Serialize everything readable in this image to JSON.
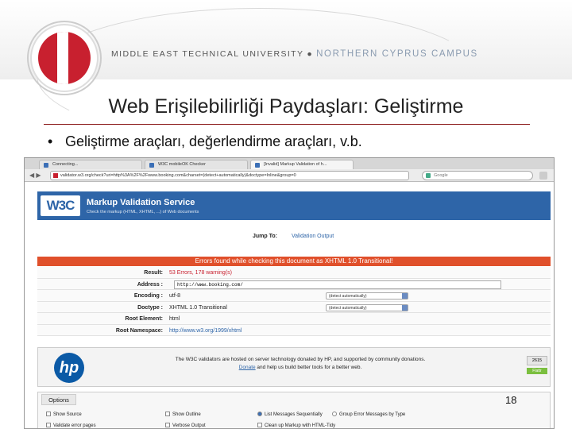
{
  "header": {
    "university": "MIDDLE EAST TECHNICAL UNIVERSITY",
    "separator": "●",
    "campus": "NORTHERN CYPRUS CAMPUS"
  },
  "slide": {
    "title": "Web Erişilebilirliği Paydaşları: Geliştirme",
    "bullet_marker": "•",
    "bullet": "Geliştirme araçları, değerlendirme araçları, v.b.",
    "page_number": "18"
  },
  "browser": {
    "tabs": [
      {
        "label": "Connecting..."
      },
      {
        "label": "W3C mobileOK Checker"
      },
      {
        "label": "[Invalid] Markup Validation of h..."
      }
    ],
    "nav_glyphs": "◀ ▶",
    "url": "validator.w3.org/check?uri=http%3A%2F%2Fwww.booking.com&charset=(detect+automatically)&doctype=Inline&group=0",
    "search_placeholder": "Google"
  },
  "validator": {
    "logo": "W3C",
    "title": "Markup Validation Service",
    "subtitle": "Check the markup (HTML, XHTML, ...) of Web documents",
    "jump_label": "Jump To:",
    "jump_link": "Validation Output",
    "error_banner": "Errors found while checking this document as XHTML 1.0 Transitional!",
    "rows": {
      "result": {
        "label": "Result:",
        "value": "53 Errors, 178 warning(s)"
      },
      "address": {
        "label": "Address :",
        "value": "http://www.booking.com/"
      },
      "encoding": {
        "label": "Encoding :",
        "value": "utf-8",
        "select": "(detect automatically)"
      },
      "doctype": {
        "label": "Doctype :",
        "value": "XHTML 1.0 Transitional",
        "select": "(detect automatically)"
      },
      "root_element": {
        "label": "Root Element:",
        "value": "html"
      },
      "root_namespace": {
        "label": "Root Namespace:",
        "value": "http://www.w3.org/1999/xhtml"
      }
    },
    "sponsor": {
      "logo": "hp",
      "line1": "The W3C validators are hosted on server technology donated by HP, and supported by community donations.",
      "donate": "Donate",
      "line2": " and help us build better tools for a better web.",
      "count": "2615",
      "flattr": "Flattr"
    },
    "options": {
      "title": "Options",
      "show_source": "Show Source",
      "show_outline": "Show Outline",
      "list_sequentially": "List Messages Sequentially",
      "group_by_type": "Group Error Messages by Type",
      "validate_error_pages": "Validate error pages",
      "verbose_output": "Verbose Output",
      "clean_up": "Clean up Markup with HTML-Tidy"
    }
  },
  "colors": {
    "w3c_blue": "#2e65a8",
    "error_red": "#e0502b",
    "metu_red": "#c8202f",
    "title_rule": "#8b1a1a"
  }
}
